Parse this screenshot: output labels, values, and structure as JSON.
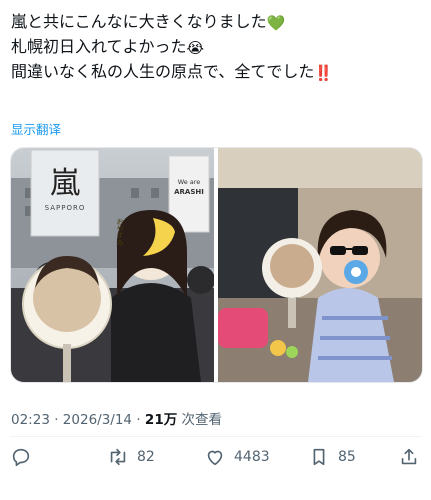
{
  "tweet": {
    "lines": [
      {
        "text": "嵐と共にこんなに大きくなりました",
        "emoji": "💚",
        "emoji_name": "green-heart-icon"
      },
      {
        "text": "札幌初日入れてよかった",
        "emoji": "😭",
        "emoji_name": "crying-face-icon"
      },
      {
        "text": "間違いなく私の人生の原点で、全てでした",
        "emoji": "‼️",
        "emoji_name": "double-exclamation-icon"
      }
    ],
    "translate_label": "显示翻译"
  },
  "media": {
    "left_photo": {
      "banner_left_logo": "嵐",
      "banner_left_sub": "SAPPORO",
      "banner_right_line1": "We are",
      "banner_right_line2": "ARASHI",
      "fan_sticker_text": "おやすみ"
    },
    "right_photo": {}
  },
  "meta": {
    "time": "02:23",
    "separator": "·",
    "date": "2026/3/14",
    "views_count": "21万",
    "views_label": "次查看"
  },
  "actions": {
    "reply_count": "",
    "retweet_count": "82",
    "like_count": "4483",
    "bookmark_count": "85"
  },
  "colors": {
    "link": "#1d9bf0",
    "muted": "#536471",
    "text": "#0f1419"
  }
}
